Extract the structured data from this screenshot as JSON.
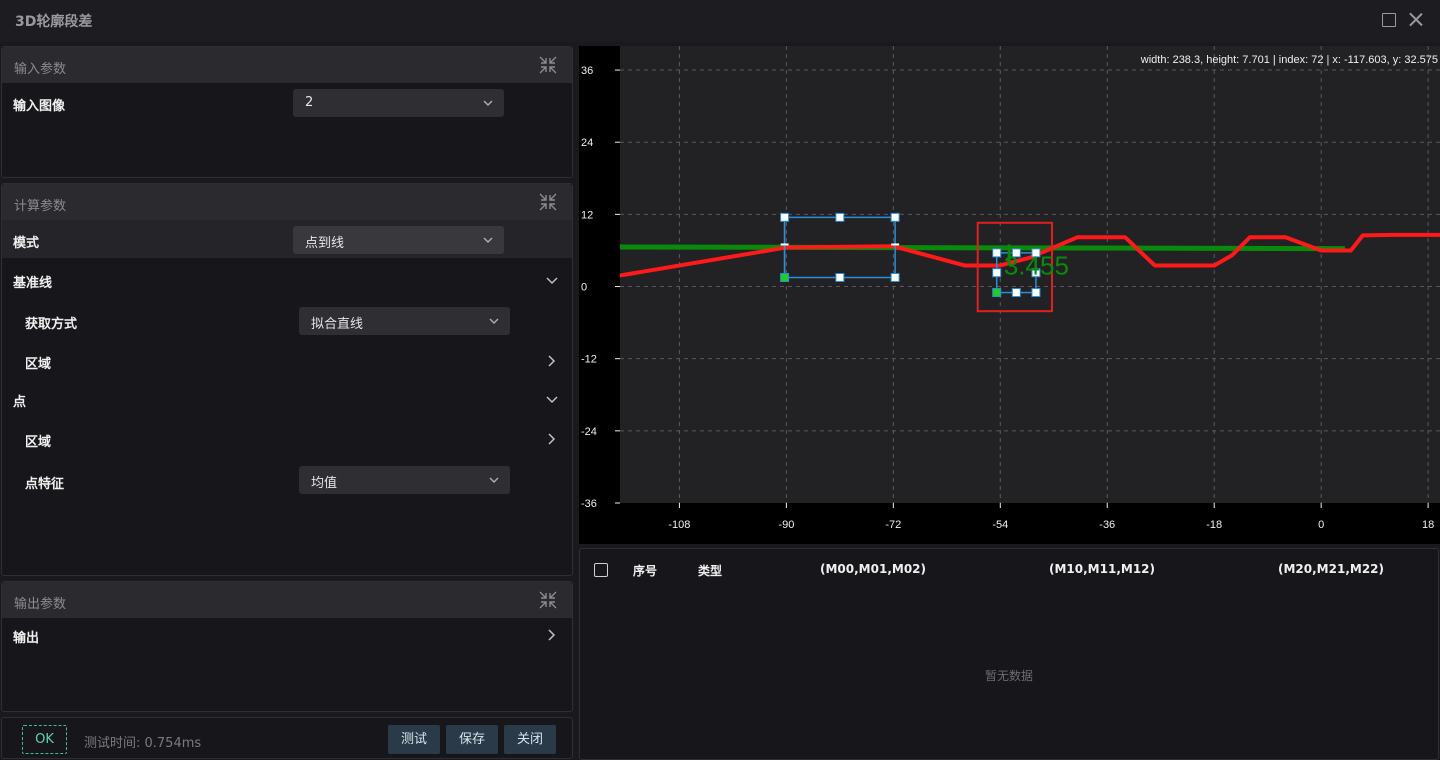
{
  "window": {
    "title": "3D轮廓段差"
  },
  "input_panel": {
    "title": "输入参数",
    "image_label": "输入图像",
    "image_value": "2"
  },
  "calc_panel": {
    "title": "计算参数",
    "mode_label": "模式",
    "mode_value": "点到线",
    "baseline_label": "基准线",
    "acquire_label": "获取方式",
    "acquire_value": "拟合直线",
    "region_label": "区域",
    "point_label": "点",
    "point_region_label": "区域",
    "feature_label": "点特征",
    "feature_value": "均值"
  },
  "output_panel": {
    "title": "输出参数",
    "output_label": "输出"
  },
  "footer": {
    "status": "OK",
    "test_time": "测试时间: 0.754ms",
    "test_button": "测试",
    "save_button": "保存",
    "close_button": "关闭"
  },
  "chart_info": "width: 238.3, height: 7.701 | index: 72 | x: -117.603, y: 32.575",
  "chart_data": {
    "type": "line",
    "x_ticks": [
      "-108",
      "-90",
      "-72",
      "-54",
      "-36",
      "-18",
      "0",
      "18"
    ],
    "y_ticks": [
      "36",
      "24",
      "12",
      "0",
      "-12",
      "-24",
      "-36"
    ],
    "measure_label": "3.455",
    "series": [
      {
        "name": "",
        "color": "#ff1a1a",
        "x": [
          -126,
          -90,
          -72,
          -60,
          -54,
          -49,
          -41,
          -33,
          -28,
          -18,
          -15,
          -12,
          -6,
          0,
          5,
          7,
          12,
          20,
          24
        ],
        "y": [
          0.5,
          6.5,
          6.7,
          3.5,
          3.5,
          4.8,
          8.2,
          8.2,
          3.5,
          3.5,
          5.2,
          8.2,
          8.2,
          6.0,
          6.0,
          8.5,
          8.6,
          8.6,
          5.5
        ]
      },
      {
        "name": "",
        "color": "#0a8a0a",
        "x": [
          -126,
          4
        ],
        "y": [
          6.6,
          6.3
        ]
      }
    ],
    "xlim": [
      -118,
      20
    ],
    "ylim": [
      -36,
      40
    ]
  },
  "table": {
    "headers": {
      "index": "序号",
      "type": "类型",
      "col1": "(M00,M01,M02)",
      "col2": "(M10,M11,M12)",
      "col3": "(M20,M21,M22)"
    },
    "empty_text": "暂无数据"
  },
  "colors": {
    "accent": "#3fb9a0",
    "profile": "#ff1a1a",
    "baseline": "#0a8a0a",
    "roi": "#2a8fd8",
    "box": "#e02020"
  }
}
